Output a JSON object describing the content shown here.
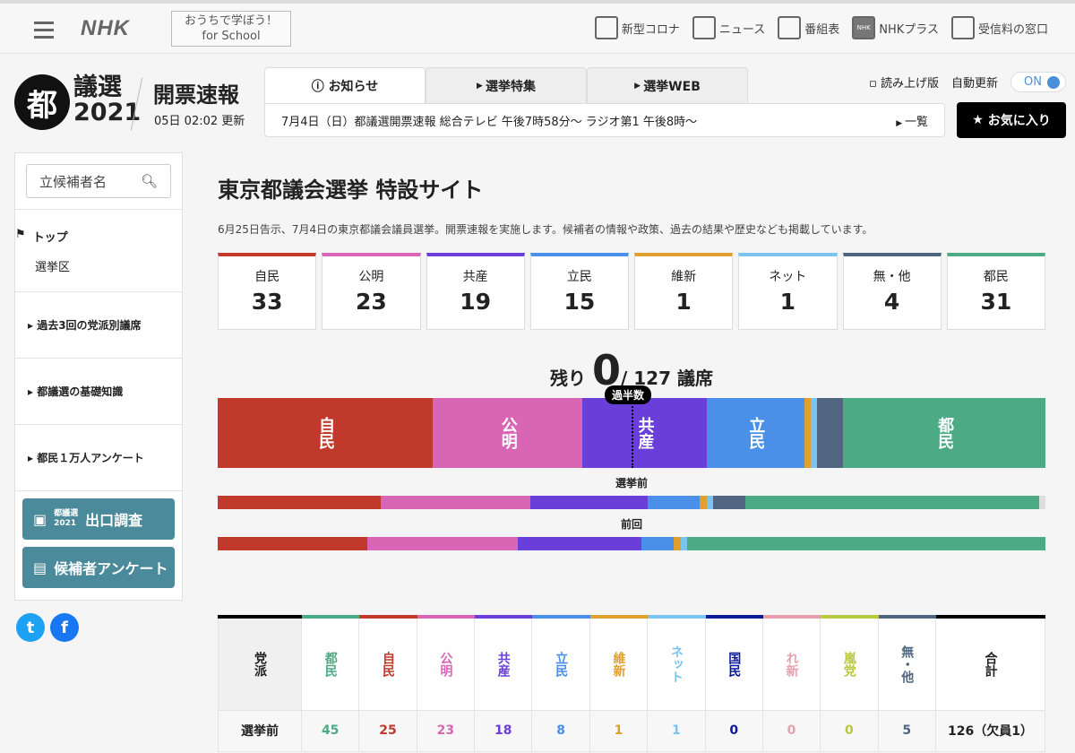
{
  "topbar": {
    "logo": "NHK",
    "school_line1": "おうちで学ぼう！",
    "school_line2": "for School",
    "nav": [
      {
        "label": "新型コロナ",
        "icon": "corona-icon"
      },
      {
        "label": "ニュース",
        "icon": "news-icon"
      },
      {
        "label": "番組表",
        "icon": "program-guide-icon"
      },
      {
        "label": "NHKプラス",
        "icon": "nhk-plus-icon"
      },
      {
        "label": "受信料の窓口",
        "icon": "domo-icon"
      }
    ]
  },
  "header": {
    "badge": "都",
    "title1": "議選",
    "title2": "2021",
    "kaihyo": "開票速報",
    "updated": "05日 02:02 更新",
    "tabs": [
      "お知らせ",
      "選挙特集",
      "選挙WEB"
    ],
    "notice": "7月4日（日）都議選開票速報 総合テレビ 午後7時58分～ ラジオ第1 午後8時～",
    "notice_link": "一覧",
    "yomiage": "読み上げ版",
    "auto_update": "自動更新",
    "toggle": "ON",
    "favorite": "お気に入り"
  },
  "sidebar": {
    "search_placeholder": "立候補者名",
    "top": "トップ",
    "district": "選挙区",
    "items": [
      "過去3回の党派別議席",
      "都議選の基礎知識",
      "都民１万人アンケート"
    ],
    "btn1_small1": "都議選",
    "btn1_small2": "2021",
    "btn1": "出口調査",
    "btn2": "候補者アンケート"
  },
  "colors": {
    "自民": "#c0392b",
    "公明": "#d966b5",
    "共産": "#6a3fd9",
    "立民": "#4a90e8",
    "維新": "#e0a030",
    "ネット": "#7cc4f0",
    "無・他": "#506680",
    "都民": "#4caa84",
    "国民": "#0a1a99",
    "れ新": "#e8a0b0",
    "嵐党": "#b8c840",
    "vacant": "#dddddd"
  },
  "main": {
    "title": "東京都議会選挙 特設サイト",
    "desc": "6月25日告示、7月4日の東京都議会議員選挙。開票速報を実施します。候補者の情報や政策、過去の結果や歴史なども掲載しています。",
    "cards": [
      {
        "name": "自民",
        "value": "33"
      },
      {
        "name": "公明",
        "value": "23"
      },
      {
        "name": "共産",
        "value": "19"
      },
      {
        "name": "立民",
        "value": "15"
      },
      {
        "name": "維新",
        "value": "1"
      },
      {
        "name": "ネット",
        "value": "1"
      },
      {
        "name": "無・他",
        "value": "4"
      },
      {
        "name": "都民",
        "value": "31"
      }
    ],
    "remain_label": "残り",
    "remain": "0",
    "total": "/ 127",
    "seats": "議席",
    "majority": "過半数",
    "bar_current": [
      [
        "自民",
        33
      ],
      [
        "公明",
        23
      ],
      [
        "共産",
        19
      ],
      [
        "立民",
        15
      ],
      [
        "維新",
        1
      ],
      [
        "ネット",
        1
      ],
      [
        "無・他",
        4
      ],
      [
        "都民",
        31
      ]
    ],
    "before_label": "選挙前",
    "bar_before": [
      [
        "自民",
        25
      ],
      [
        "公明",
        23
      ],
      [
        "共産",
        18
      ],
      [
        "立民",
        8
      ],
      [
        "維新",
        1
      ],
      [
        "ネット",
        1
      ],
      [
        "無・他",
        5
      ],
      [
        "都民",
        45
      ],
      [
        "vacant",
        1
      ]
    ],
    "prev_label": "前回",
    "bar_prev": [
      [
        "自民",
        23
      ],
      [
        "公明",
        23
      ],
      [
        "共産",
        19
      ],
      [
        "立民",
        5
      ],
      [
        "維新",
        1
      ],
      [
        "ネット",
        1
      ],
      [
        "都民",
        55
      ]
    ]
  },
  "table": {
    "header": "党派",
    "parties": [
      "都民",
      "自民",
      "公明",
      "共産",
      "立民",
      "維新",
      "ネット",
      "国民",
      "れ新",
      "嵐党",
      "無・他"
    ],
    "total": "合計",
    "rows": [
      {
        "label": "選挙前",
        "values": [
          "45",
          "25",
          "23",
          "18",
          "8",
          "1",
          "1",
          "0",
          "0",
          "0",
          "5"
        ],
        "total": "126（欠員1）"
      }
    ]
  }
}
